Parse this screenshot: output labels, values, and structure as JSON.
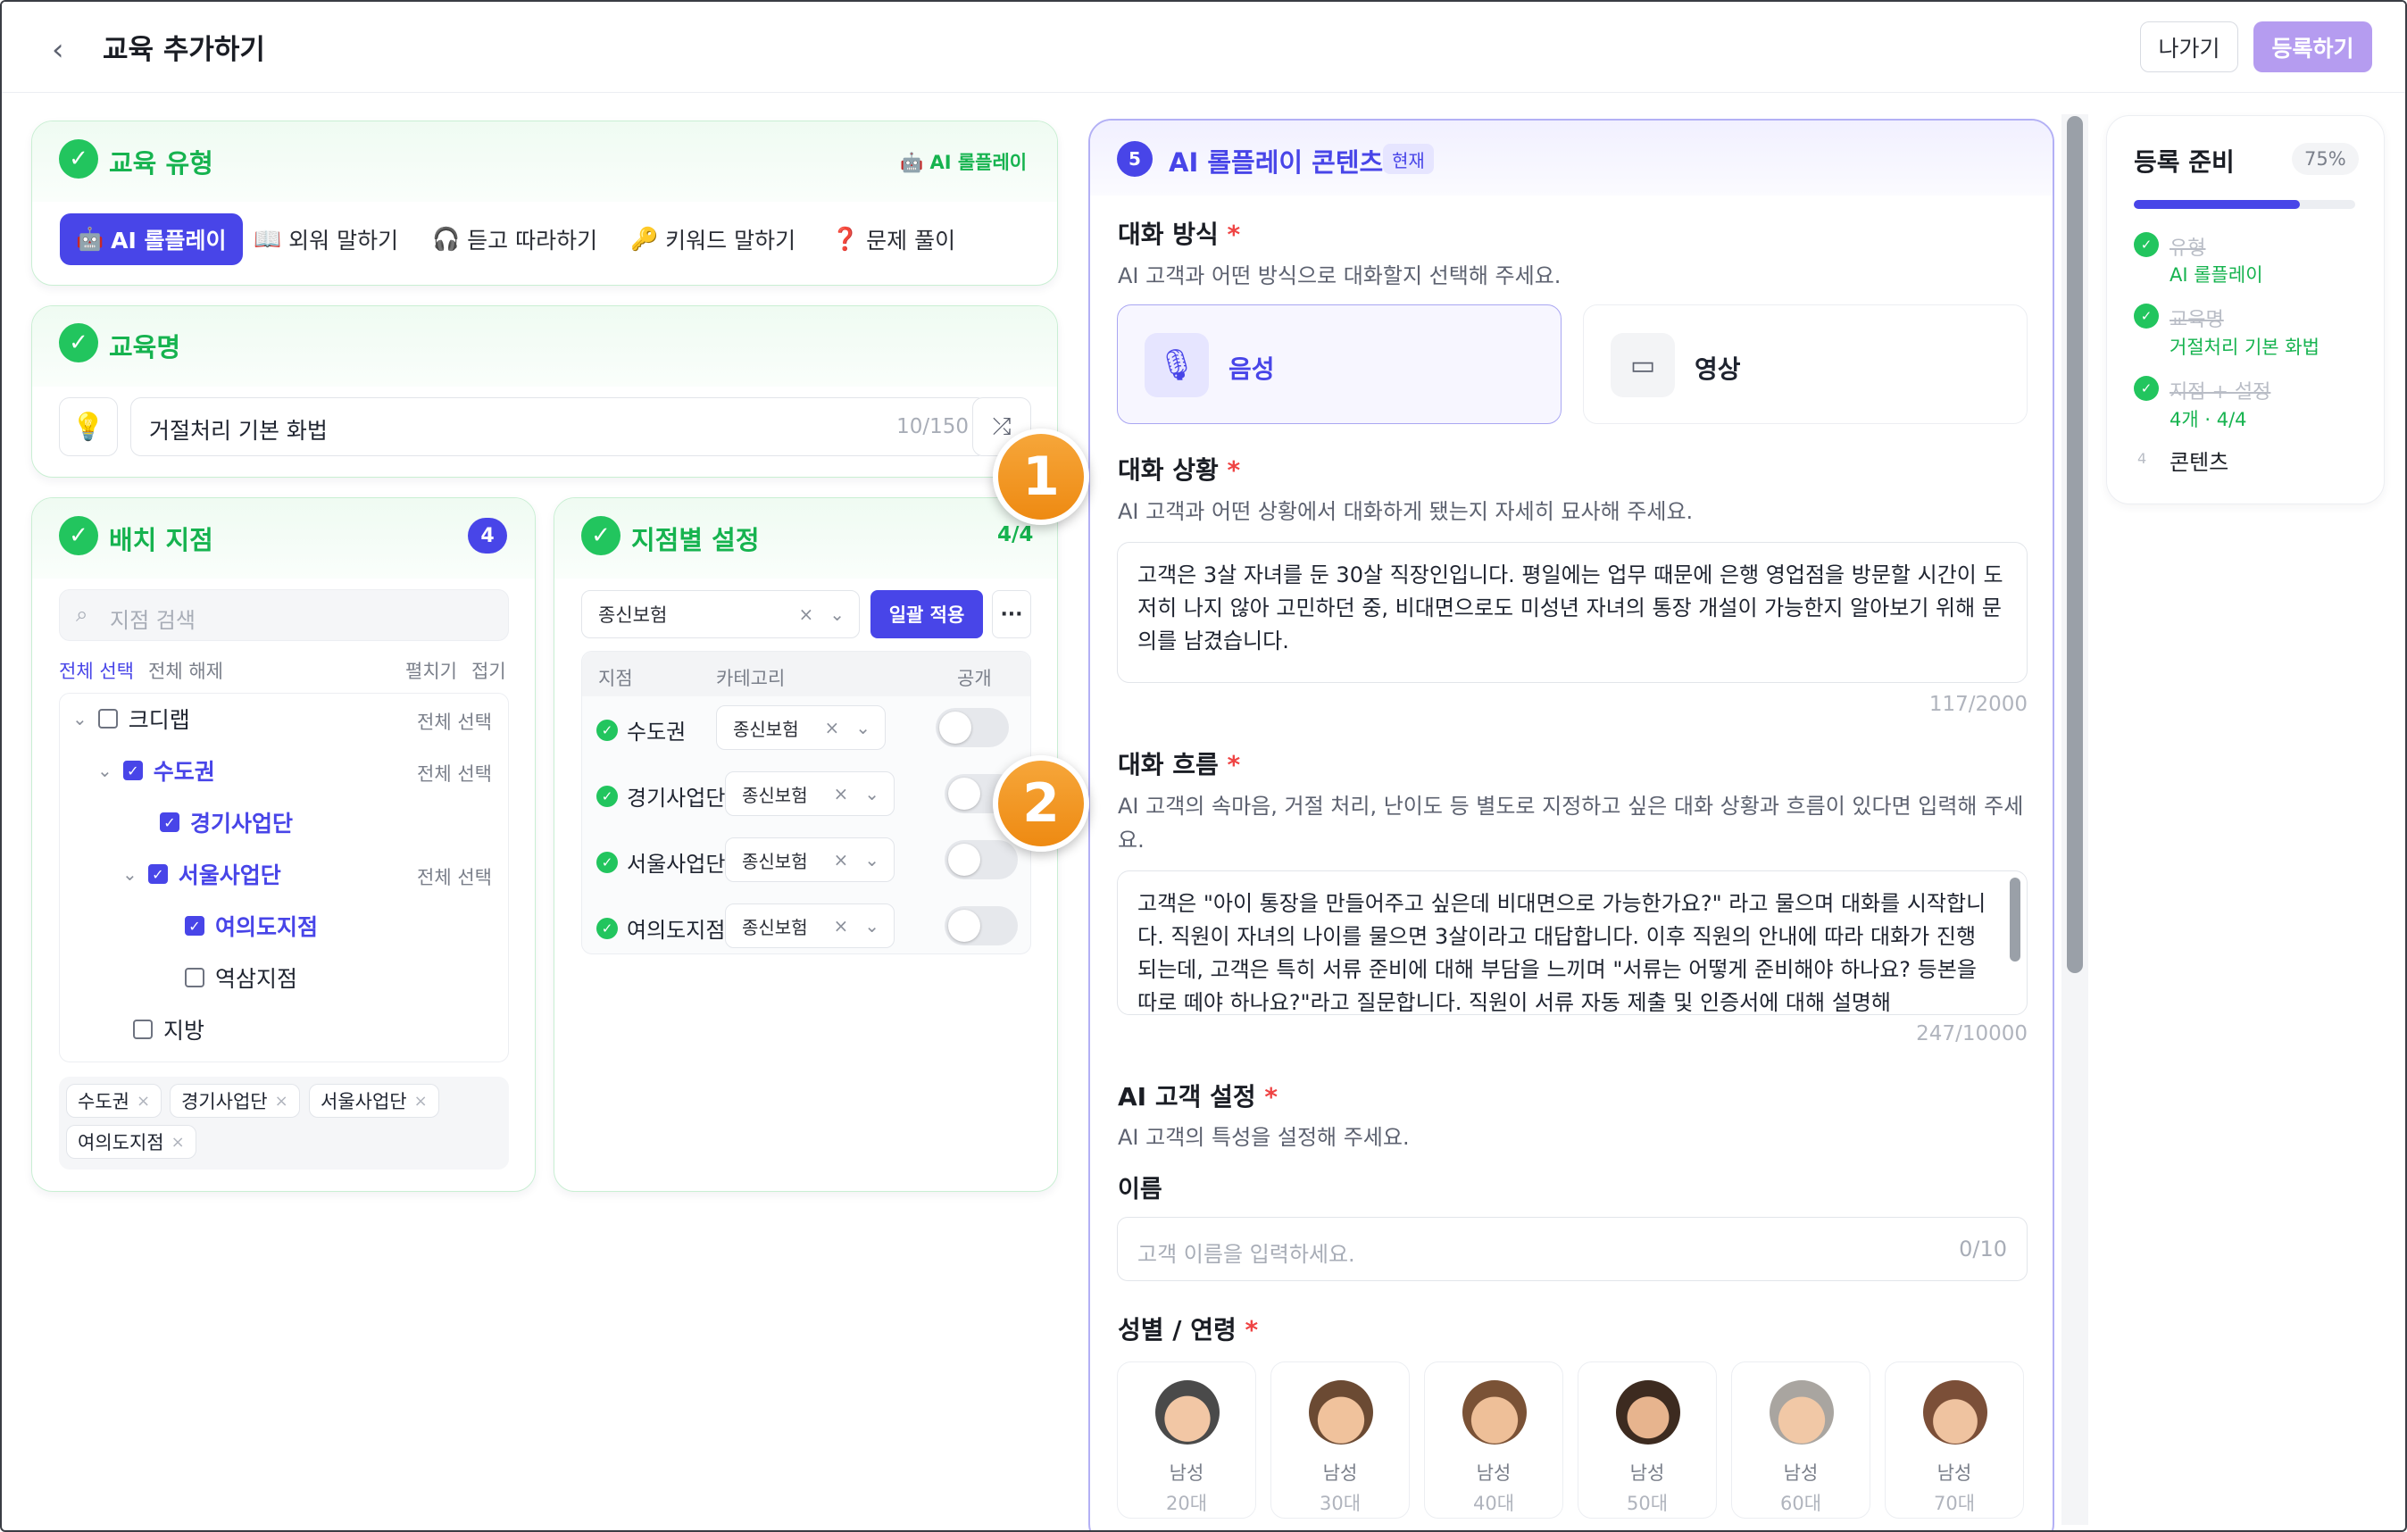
{
  "header": {
    "title": "교육 추가하기",
    "exit_label": "나가기",
    "register_label": "등록하기"
  },
  "edu_type": {
    "title": "교육 유형",
    "badge": "AI 롤플레이",
    "tabs": [
      {
        "icon": "🤖",
        "label": "AI 롤플레이",
        "active": true
      },
      {
        "icon": "📖",
        "label": "외워 말하기"
      },
      {
        "icon": "🎧",
        "label": "듣고 따라하기"
      },
      {
        "icon": "🔑",
        "label": "키워드 말하기"
      },
      {
        "icon": "❓",
        "label": "문제 풀이"
      }
    ]
  },
  "edu_name": {
    "title": "교육명",
    "value": "거절처리 기본 화법",
    "count": "10/150"
  },
  "branches": {
    "title": "배치 지점",
    "count": "4",
    "search_placeholder": "지점 검색",
    "select_all": "전체 선택",
    "deselect_all": "전체 해제",
    "expand": "펼치기",
    "collapse": "접기",
    "tree": [
      {
        "label": "크디랩",
        "checked": false,
        "sel": "전체 선택"
      },
      {
        "label": "수도권",
        "checked": true,
        "sel": "전체 선택"
      },
      {
        "label": "경기사업단",
        "checked": true
      },
      {
        "label": "서울사업단",
        "checked": true,
        "sel": "전체 선택"
      },
      {
        "label": "여의도지점",
        "checked": true
      },
      {
        "label": "역삼지점",
        "checked": false
      },
      {
        "label": "지방",
        "checked": false
      }
    ],
    "chips": [
      "수도권",
      "경기사업단",
      "서울사업단",
      "여의도지점"
    ]
  },
  "branch_settings": {
    "title": "지점별 설정",
    "count": "4/4",
    "category_value": "종신보험",
    "apply_all": "일괄 적용",
    "more": "···",
    "col_branch": "지점",
    "col_category": "카테고리",
    "col_public": "공개",
    "rows": [
      {
        "branch": "수도권",
        "category": "종신보험"
      },
      {
        "branch": "경기사업단",
        "category": "종신보험"
      },
      {
        "branch": "서울사업단",
        "category": "종신보험"
      },
      {
        "branch": "여의도지점",
        "category": "종신보험"
      }
    ]
  },
  "content": {
    "step": "5",
    "title": "AI 롤플레이 콘텐츠",
    "current": "현재",
    "mode_label": "대화 방식",
    "mode_desc": "AI 고객과 어떤 방식으로 대화할지 선택해 주세요.",
    "mode_voice": "음성",
    "mode_video": "영상",
    "situation_label": "대화 상황",
    "situation_desc": "AI 고객과 어떤 상황에서 대화하게 됐는지 자세히 묘사해 주세요.",
    "situation_text": "고객은 3살 자녀를 둔 30살 직장인입니다. 평일에는 업무 때문에 은행 영업점을 방문할 시간이 도저히 나지 않아 고민하던 중, 비대면으로도 미성년 자녀의 통장 개설이 가능한지 알아보기 위해 문의를 남겼습니다.",
    "situation_count": "117/2000",
    "flow_label": "대화 흐름",
    "flow_desc": "AI 고객의 속마음, 거절 처리, 난이도 등 별도로 지정하고 싶은 대화 상황과 흐름이 있다면 입력해 주세요.",
    "flow_text": "고객은 \"아이 통장을 만들어주고 싶은데 비대면으로 가능한가요?\" 라고 물으며 대화를 시작합니다. 직원이 자녀의 나이를 물으면 3살이라고 대답합니다. 이후 직원의 안내에 따라 대화가 진행되는데, 고객은 특히 서류 준비에 대해 부담을 느끼며 \"서류는 어떻게 준비해야 하나요? 등본을 따로 떼야 하나요?\"라고 질문합니다. 직원이 서류 자동 제출 및 인증서에 대해 설명해",
    "flow_count": "247/10000",
    "customer_label": "AI 고객 설정",
    "customer_desc": "AI 고객의 특성을 설정해 주세요.",
    "name_label": "이름",
    "name_placeholder": "고객 이름을 입력하세요.",
    "name_count": "0/10",
    "gender_label": "성별 / 연령",
    "avatars": [
      {
        "gender": "남성",
        "age": "20대"
      },
      {
        "gender": "남성",
        "age": "30대"
      },
      {
        "gender": "남성",
        "age": "40대"
      },
      {
        "gender": "남성",
        "age": "50대"
      },
      {
        "gender": "남성",
        "age": "60대"
      },
      {
        "gender": "남성",
        "age": "70대"
      }
    ]
  },
  "progress": {
    "title": "등록 준비",
    "percent": "75%",
    "fill": 0.75,
    "steps": [
      {
        "title": "유형",
        "sub": "AI 롤플레이"
      },
      {
        "title": "교육명",
        "sub": "거절처리 기본 화법"
      },
      {
        "title": "지점 + 설정",
        "sub": "4개 · 4/4"
      }
    ],
    "step4_num": "4",
    "step4_label": "콘텐츠"
  },
  "callouts": [
    "1",
    "2"
  ],
  "colors": {
    "accent": "#4845e8",
    "green": "#22c55e",
    "callout": "#f09a22"
  }
}
